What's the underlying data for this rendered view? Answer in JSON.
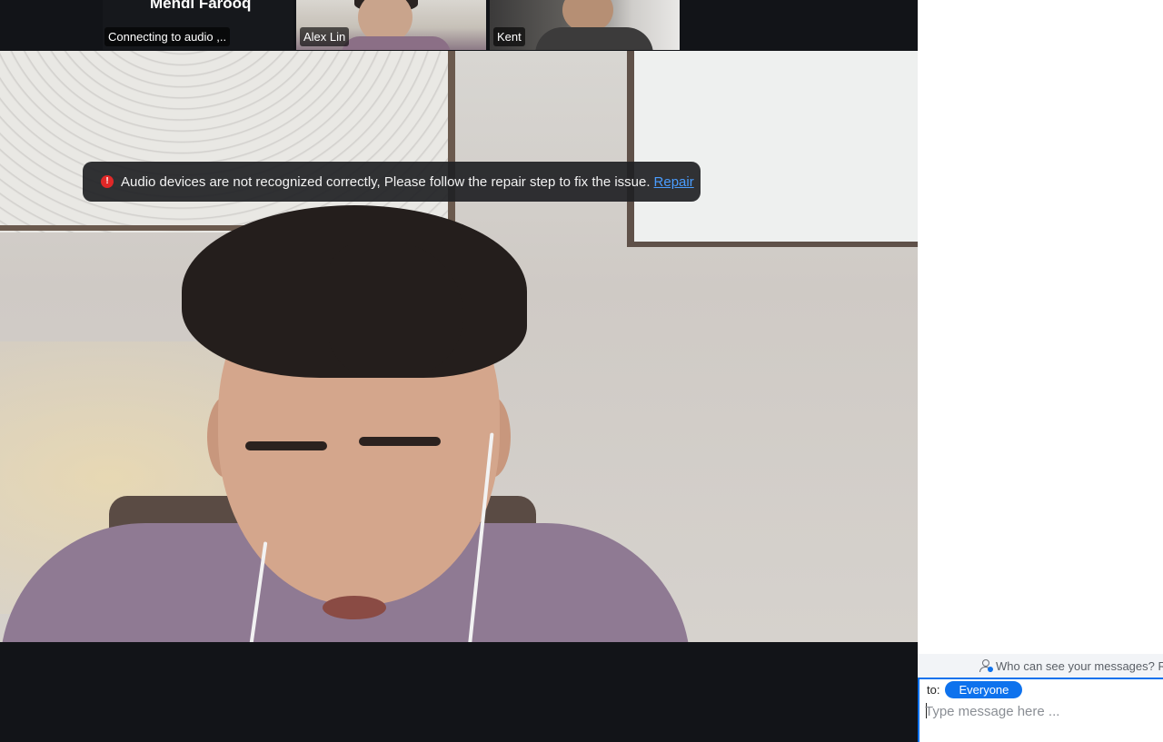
{
  "participants": {
    "self_tile": {
      "name": "Mehdi Farooq",
      "status": "Connecting to audio ,.."
    },
    "tiles": [
      {
        "name": "Alex Lin"
      },
      {
        "name": "Kent"
      }
    ]
  },
  "notification": {
    "message": "Audio devices are not recognized correctly, Please follow the repair step to fix the issue.",
    "action_label": "Repair",
    "icon": "alert-icon",
    "icon_color": "#e02828"
  },
  "chat": {
    "visibility_text": "Who can see your messages? Re",
    "to_label": "to:",
    "recipient": "Everyone",
    "input_placeholder": "Type message here ...",
    "input_value": "",
    "accent_color": "#0e72ed"
  }
}
